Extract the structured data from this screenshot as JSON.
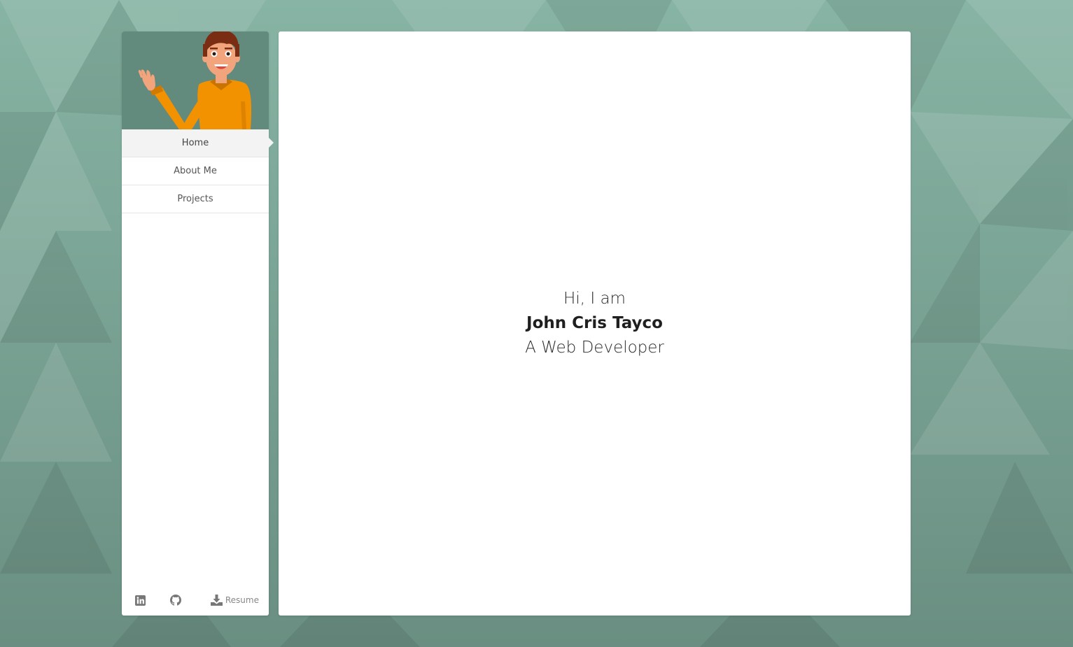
{
  "colors": {
    "background": "#7aa596",
    "avatar_bg": "#628a7d",
    "shirt": "#f39200",
    "hair": "#7b2d13",
    "skin": "#f2a47c",
    "icon_gray": "#777777"
  },
  "sidebar": {
    "avatar_icon": "waving-developer-illustration",
    "nav": [
      {
        "label": "Home",
        "active": true
      },
      {
        "label": "About Me",
        "active": false
      },
      {
        "label": "Projects",
        "active": false
      }
    ],
    "footer": {
      "linkedin_icon": "linkedin-icon",
      "github_icon": "github-icon",
      "download_icon": "download-icon",
      "resume_label": "Resume"
    }
  },
  "main": {
    "greeting": "Hi, I am",
    "name": "John Cris Tayco",
    "role": "A Web Developer"
  }
}
